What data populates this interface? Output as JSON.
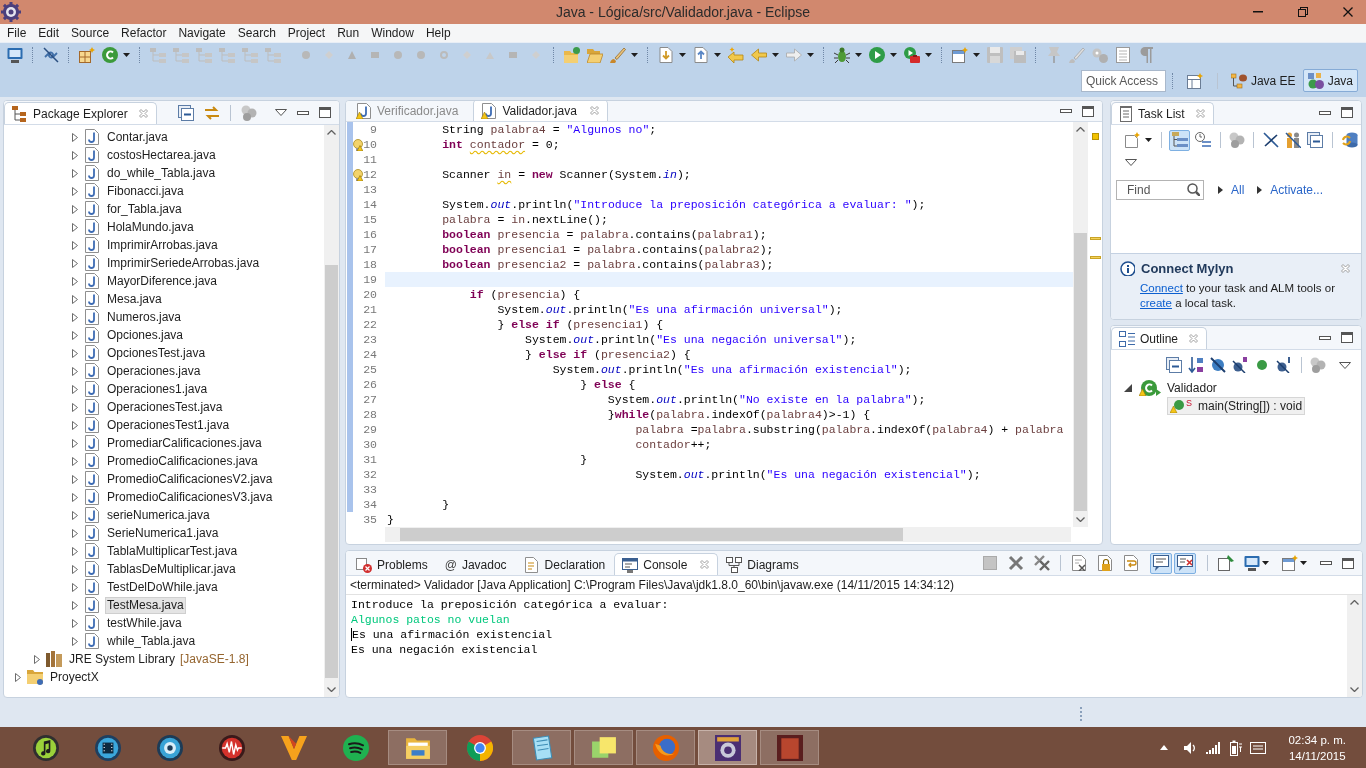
{
  "window": {
    "title": "Java - Lógica/src/Validador.java - Eclipse"
  },
  "menu": [
    "File",
    "Edit",
    "Source",
    "Refactor",
    "Navigate",
    "Search",
    "Project",
    "Run",
    "Window",
    "Help"
  ],
  "quick_access": {
    "placeholder": "Quick Access"
  },
  "perspectives": [
    {
      "label": "Java EE",
      "selected": false
    },
    {
      "label": "Java",
      "selected": true
    }
  ],
  "package_explorer": {
    "title": "Package Explorer",
    "tree": [
      {
        "children": [
          {
            "children": [
              {
                "children": [
                  {
                    "label": "Contar.java",
                    "kind": "java_file",
                    "expanded": false,
                    "selected": false
                  },
                  {
                    "label": "costosHectarea.java",
                    "kind": "java_file",
                    "expanded": false,
                    "selected": false
                  },
                  {
                    "label": "do_while_Tabla.java",
                    "kind": "java_file",
                    "expanded": false,
                    "selected": false
                  },
                  {
                    "label": "Fibonacci.java",
                    "kind": "java_file",
                    "expanded": false,
                    "selected": false
                  },
                  {
                    "label": "for_Tabla.java",
                    "kind": "java_file",
                    "expanded": false,
                    "selected": false
                  },
                  {
                    "label": "HolaMundo.java",
                    "kind": "java_file",
                    "expanded": false,
                    "selected": false
                  },
                  {
                    "label": "ImprimirArrobas.java",
                    "kind": "java_file",
                    "expanded": false,
                    "selected": false
                  },
                  {
                    "label": "ImprimirSeriedeArrobas.java",
                    "kind": "java_file",
                    "expanded": false,
                    "selected": false
                  },
                  {
                    "label": "MayorDiference.java",
                    "kind": "java_file",
                    "expanded": false,
                    "selected": false
                  },
                  {
                    "label": "Mesa.java",
                    "kind": "java_file",
                    "expanded": false,
                    "selected": false
                  },
                  {
                    "label": "Numeros.java",
                    "kind": "java_file",
                    "expanded": false,
                    "selected": false
                  },
                  {
                    "label": "Opciones.java",
                    "kind": "java_file",
                    "expanded": false,
                    "selected": false
                  },
                  {
                    "label": "OpcionesTest.java",
                    "kind": "java_file",
                    "expanded": false,
                    "selected": false
                  },
                  {
                    "label": "Operaciones.java",
                    "kind": "java_file",
                    "expanded": false,
                    "selected": false
                  },
                  {
                    "label": "Operaciones1.java",
                    "kind": "java_file",
                    "expanded": false,
                    "selected": false
                  },
                  {
                    "label": "OperacionesTest.java",
                    "kind": "java_file",
                    "expanded": false,
                    "selected": false
                  },
                  {
                    "label": "OperacionesTest1.java",
                    "kind": "java_file",
                    "expanded": false,
                    "selected": false
                  },
                  {
                    "label": "PromediarCalificaciones.java",
                    "kind": "java_file",
                    "expanded": false,
                    "selected": false
                  },
                  {
                    "label": "PromedioCalificaciones.java",
                    "kind": "java_file",
                    "expanded": false,
                    "selected": false
                  },
                  {
                    "label": "PromedioCalificacionesV2.java",
                    "kind": "java_file",
                    "expanded": false,
                    "selected": false
                  },
                  {
                    "label": "PromedioCalificacionesV3.java",
                    "kind": "java_file",
                    "expanded": false,
                    "selected": false
                  },
                  {
                    "label": "serieNumerica.java",
                    "kind": "java_file",
                    "expanded": false,
                    "selected": false
                  },
                  {
                    "label": "SerieNumerica1.java",
                    "kind": "java_file",
                    "expanded": false,
                    "selected": false
                  },
                  {
                    "label": "TablaMultiplicarTest.java",
                    "kind": "java_file",
                    "expanded": false,
                    "selected": false
                  },
                  {
                    "label": "TablasDeMultiplicar.java",
                    "kind": "java_file",
                    "expanded": false,
                    "selected": false
                  },
                  {
                    "label": "TestDelDoWhile.java",
                    "kind": "java_file",
                    "expanded": false,
                    "selected": false
                  },
                  {
                    "label": "TestMesa.java",
                    "kind": "java_file",
                    "expanded": false,
                    "selected": true
                  },
                  {
                    "label": "testWhile.java",
                    "kind": "java_file",
                    "expanded": false,
                    "selected": false
                  },
                  {
                    "label": "while_Tabla.java",
                    "kind": "java_file",
                    "expanded": false,
                    "selected": false
                  }
                ]
              }
            ]
          },
          {
            "label": "JRE System Library",
            "decoration": "[JavaSE-1.8]",
            "kind": "library",
            "expanded": false,
            "selected": false
          }
        ]
      },
      {
        "label": "ProyectX",
        "kind": "project",
        "expanded": false,
        "selected": false
      }
    ]
  },
  "editor": {
    "tabs": [
      {
        "label": "Verificador.java",
        "selected": false
      },
      {
        "label": "Validador.java",
        "selected": true
      }
    ],
    "lines": [
      {
        "number": "9",
        "changed": true,
        "warning": false,
        "current": false,
        "tokens": [
          {
            "text": "        String ",
            "kind": "plain"
          },
          {
            "text": "palabra4",
            "kind": "variable"
          },
          {
            "text": " = ",
            "kind": "plain"
          },
          {
            "text": "\"Algunos no\"",
            "kind": "string"
          },
          {
            "text": ";",
            "kind": "plain"
          }
        ]
      },
      {
        "number": "10",
        "changed": true,
        "warning": true,
        "current": false,
        "tokens": [
          {
            "text": "        int ",
            "kind": "keyword"
          },
          {
            "text": "contador",
            "kind": "flagged_variable"
          },
          {
            "text": " = 0;",
            "kind": "plain"
          }
        ]
      },
      {
        "number": "11",
        "changed": true,
        "warning": false,
        "current": false
      },
      {
        "number": "12",
        "changed": true,
        "warning": true,
        "current": false,
        "tokens": [
          {
            "text": "        Scanner ",
            "kind": "plain"
          },
          {
            "text": "in",
            "kind": "flagged_variable"
          },
          {
            "text": " = ",
            "kind": "plain"
          },
          {
            "text": "new",
            "kind": "keyword"
          },
          {
            "text": " Scanner(System.",
            "kind": "plain"
          },
          {
            "text": "in",
            "kind": "field"
          },
          {
            "text": ");",
            "kind": "plain"
          }
        ]
      },
      {
        "number": "13",
        "changed": true,
        "warning": false,
        "current": false
      },
      {
        "number": "14",
        "changed": true,
        "warning": false,
        "current": false,
        "tokens": [
          {
            "text": "        System.",
            "kind": "plain"
          },
          {
            "text": "out",
            "kind": "field"
          },
          {
            "text": ".println(",
            "kind": "plain"
          },
          {
            "text": "\"Introduce la preposición categórica a evaluar: \"",
            "kind": "string"
          },
          {
            "text": ");",
            "kind": "plain"
          }
        ]
      },
      {
        "number": "15",
        "changed": true,
        "warning": false,
        "current": false,
        "tokens": [
          {
            "text": "        palabra",
            "kind": "variable"
          },
          {
            "text": " = ",
            "kind": "plain"
          },
          {
            "text": "in",
            "kind": "variable"
          },
          {
            "text": ".nextLine();",
            "kind": "plain"
          }
        ]
      },
      {
        "number": "16",
        "changed": true,
        "warning": false,
        "current": false,
        "tokens": [
          {
            "text": "        boolean ",
            "kind": "keyword"
          },
          {
            "text": "presencia",
            "kind": "variable"
          },
          {
            "text": " = ",
            "kind": "plain"
          },
          {
            "text": "palabra",
            "kind": "variable"
          },
          {
            "text": ".contains(",
            "kind": "plain"
          },
          {
            "text": "palabra1",
            "kind": "variable"
          },
          {
            "text": ");",
            "kind": "plain"
          }
        ]
      },
      {
        "number": "17",
        "changed": true,
        "warning": false,
        "current": false,
        "tokens": [
          {
            "text": "        boolean ",
            "kind": "keyword"
          },
          {
            "text": "presencia1",
            "kind": "variable"
          },
          {
            "text": " = ",
            "kind": "plain"
          },
          {
            "text": "palabra",
            "kind": "variable"
          },
          {
            "text": ".contains(",
            "kind": "plain"
          },
          {
            "text": "palabra2",
            "kind": "variable"
          },
          {
            "text": ");",
            "kind": "plain"
          }
        ]
      },
      {
        "number": "18",
        "changed": true,
        "warning": false,
        "current": false,
        "tokens": [
          {
            "text": "        boolean ",
            "kind": "keyword"
          },
          {
            "text": "presencia2",
            "kind": "variable"
          },
          {
            "text": " = ",
            "kind": "plain"
          },
          {
            "text": "palabra",
            "kind": "variable"
          },
          {
            "text": ".contains(",
            "kind": "plain"
          },
          {
            "text": "palabra3",
            "kind": "variable"
          },
          {
            "text": ");",
            "kind": "plain"
          }
        ]
      },
      {
        "number": "19",
        "changed": true,
        "warning": false,
        "current": true
      },
      {
        "number": "20",
        "changed": true,
        "warning": false,
        "current": false,
        "tokens": [
          {
            "text": "            if",
            "kind": "keyword"
          },
          {
            "text": " (",
            "kind": "plain"
          },
          {
            "text": "presencia",
            "kind": "variable"
          },
          {
            "text": ") {",
            "kind": "plain"
          }
        ]
      },
      {
        "number": "21",
        "changed": true,
        "warning": false,
        "current": false,
        "tokens": [
          {
            "text": "                System.",
            "kind": "plain"
          },
          {
            "text": "out",
            "kind": "field"
          },
          {
            "text": ".println(",
            "kind": "plain"
          },
          {
            "text": "\"Es una afirmación universal\"",
            "kind": "string"
          },
          {
            "text": ");",
            "kind": "plain"
          }
        ]
      },
      {
        "number": "22",
        "changed": true,
        "warning": false,
        "current": false,
        "tokens": [
          {
            "text": "                } ",
            "kind": "plain"
          },
          {
            "text": "else if",
            "kind": "keyword"
          },
          {
            "text": " (",
            "kind": "plain"
          },
          {
            "text": "presencia1",
            "kind": "variable"
          },
          {
            "text": ") {",
            "kind": "plain"
          }
        ]
      },
      {
        "number": "23",
        "changed": true,
        "warning": false,
        "current": false,
        "tokens": [
          {
            "text": "                    System.",
            "kind": "plain"
          },
          {
            "text": "out",
            "kind": "field"
          },
          {
            "text": ".println(",
            "kind": "plain"
          },
          {
            "text": "\"Es una negación universal\"",
            "kind": "string"
          },
          {
            "text": ");",
            "kind": "plain"
          }
        ]
      },
      {
        "number": "24",
        "changed": true,
        "warning": false,
        "current": false,
        "tokens": [
          {
            "text": "                    } ",
            "kind": "plain"
          },
          {
            "text": "else if",
            "kind": "keyword"
          },
          {
            "text": " (",
            "kind": "plain"
          },
          {
            "text": "presencia2",
            "kind": "variable"
          },
          {
            "text": ") {",
            "kind": "plain"
          }
        ]
      },
      {
        "number": "25",
        "changed": true,
        "warning": false,
        "current": false,
        "tokens": [
          {
            "text": "                        System.",
            "kind": "plain"
          },
          {
            "text": "out",
            "kind": "field"
          },
          {
            "text": ".println(",
            "kind": "plain"
          },
          {
            "text": "\"Es una afirmación existencial\"",
            "kind": "string"
          },
          {
            "text": ");",
            "kind": "plain"
          }
        ]
      },
      {
        "number": "26",
        "changed": true,
        "warning": false,
        "current": false,
        "tokens": [
          {
            "text": "                            } ",
            "kind": "plain"
          },
          {
            "text": "else",
            "kind": "keyword"
          },
          {
            "text": " {",
            "kind": "plain"
          }
        ]
      },
      {
        "number": "27",
        "changed": true,
        "warning": false,
        "current": false,
        "tokens": [
          {
            "text": "                                System.",
            "kind": "plain"
          },
          {
            "text": "out",
            "kind": "field"
          },
          {
            "text": ".println(",
            "kind": "plain"
          },
          {
            "text": "\"No existe en la palabra\"",
            "kind": "string"
          },
          {
            "text": ");",
            "kind": "plain"
          }
        ]
      },
      {
        "number": "28",
        "changed": true,
        "warning": false,
        "current": false,
        "tokens": [
          {
            "text": "                                }",
            "kind": "plain"
          },
          {
            "text": "while",
            "kind": "keyword"
          },
          {
            "text": "(",
            "kind": "plain"
          },
          {
            "text": "palabra",
            "kind": "variable"
          },
          {
            "text": ".indexOf(",
            "kind": "plain"
          },
          {
            "text": "palabra4",
            "kind": "variable"
          },
          {
            "text": ")>-1) {",
            "kind": "plain"
          }
        ]
      },
      {
        "number": "29",
        "changed": true,
        "warning": false,
        "current": false,
        "tokens": [
          {
            "text": "                                    palabra",
            "kind": "variable"
          },
          {
            "text": " =",
            "kind": "plain"
          },
          {
            "text": "palabra",
            "kind": "variable"
          },
          {
            "text": ".substring(",
            "kind": "plain"
          },
          {
            "text": "palabra",
            "kind": "variable"
          },
          {
            "text": ".indexOf(",
            "kind": "plain"
          },
          {
            "text": "palabra4",
            "kind": "variable"
          },
          {
            "text": ") + ",
            "kind": "plain"
          },
          {
            "text": "palabra",
            "kind": "variable"
          }
        ]
      },
      {
        "number": "30",
        "changed": true,
        "warning": false,
        "current": false,
        "tokens": [
          {
            "text": "                                    contador",
            "kind": "variable"
          },
          {
            "text": "++;",
            "kind": "plain"
          }
        ]
      },
      {
        "number": "31",
        "changed": true,
        "warning": false,
        "current": false,
        "tokens": [
          {
            "text": "                            }",
            "kind": "plain"
          }
        ]
      },
      {
        "number": "32",
        "changed": true,
        "warning": false,
        "current": false,
        "tokens": [
          {
            "text": "                                    System.",
            "kind": "plain"
          },
          {
            "text": "out",
            "kind": "field"
          },
          {
            "text": ".println(",
            "kind": "plain"
          },
          {
            "text": "\"Es una negación existencial\"",
            "kind": "string"
          },
          {
            "text": ");",
            "kind": "plain"
          }
        ]
      },
      {
        "number": "33",
        "changed": true,
        "warning": false,
        "current": false
      },
      {
        "number": "34",
        "changed": true,
        "warning": false,
        "current": false,
        "tokens": [
          {
            "text": "        }",
            "kind": "plain"
          }
        ]
      },
      {
        "number": "35",
        "changed": false,
        "warning": false,
        "current": false,
        "tokens": [
          {
            "text": "}",
            "kind": "plain"
          }
        ]
      }
    ]
  },
  "task_list": {
    "title": "Task List",
    "view_modes": [
      {
        "selected": true
      },
      {
        "selected": false
      }
    ],
    "find": {
      "placeholder": "Find"
    },
    "filters": [
      "All",
      "Activate..."
    ],
    "notice": {
      "title": "Connect Mylyn",
      "message": [
        {
          "text": "Connect",
          "kind": "link"
        },
        {
          "text": " to your task and ALM tools or ",
          "kind": "text"
        },
        {
          "text": "create",
          "kind": "link"
        },
        {
          "text": " a local task.",
          "kind": "text"
        }
      ]
    }
  },
  "outline": {
    "title": "Outline",
    "tree": [
      {
        "label": "Validador",
        "expanded": true,
        "selected": false,
        "children": [
          {
            "label": "main(String[]) : void",
            "modifier": "S",
            "selected": true
          }
        ]
      }
    ]
  },
  "console": {
    "tabs": [
      {
        "label": "Problems",
        "kind": "problems",
        "selected": false
      },
      {
        "label": "Javadoc",
        "kind": "javadoc",
        "glyph": "@",
        "selected": false
      },
      {
        "label": "Declaration",
        "kind": "declaration",
        "selected": false
      },
      {
        "label": "Console",
        "kind": "console",
        "selected": true
      },
      {
        "label": "Diagrams",
        "kind": "diagrams",
        "selected": false
      }
    ],
    "toggles": [
      {
        "on": true
      },
      {
        "on": true
      }
    ],
    "status": "<terminated> Validador [Java Application] C:\\Program Files\\Java\\jdk1.8.0_60\\bin\\javaw.exe (14/11/2015 14:34:12)",
    "output": [
      {
        "text": "Introduce la preposición categórica a evaluar:",
        "kind": "stdout",
        "caret": false
      },
      {
        "text": "Algunos patos no vuelan",
        "kind": "stdin",
        "caret": false
      },
      {
        "text": "Es una afirmación existencial",
        "kind": "stdout",
        "caret": true
      },
      {
        "text": "Es una negación existencial",
        "kind": "stdout",
        "caret": false
      }
    ]
  },
  "taskbar": {
    "apps": [
      {
        "running": false,
        "active": false
      },
      {
        "running": false,
        "active": false
      },
      {
        "running": false,
        "active": false
      },
      {
        "running": false,
        "active": false
      },
      {
        "running": false,
        "active": false
      },
      {
        "running": false,
        "active": false
      },
      {
        "running": true,
        "active": false
      },
      {
        "running": false,
        "active": false
      },
      {
        "running": true,
        "active": false
      },
      {
        "running": true,
        "active": false
      },
      {
        "running": true,
        "active": false
      },
      {
        "running": true,
        "active": true
      },
      {
        "running": true,
        "active": false
      }
    ],
    "clock": {
      "time": "02:34 p. m.",
      "date": "14/11/2015"
    }
  }
}
